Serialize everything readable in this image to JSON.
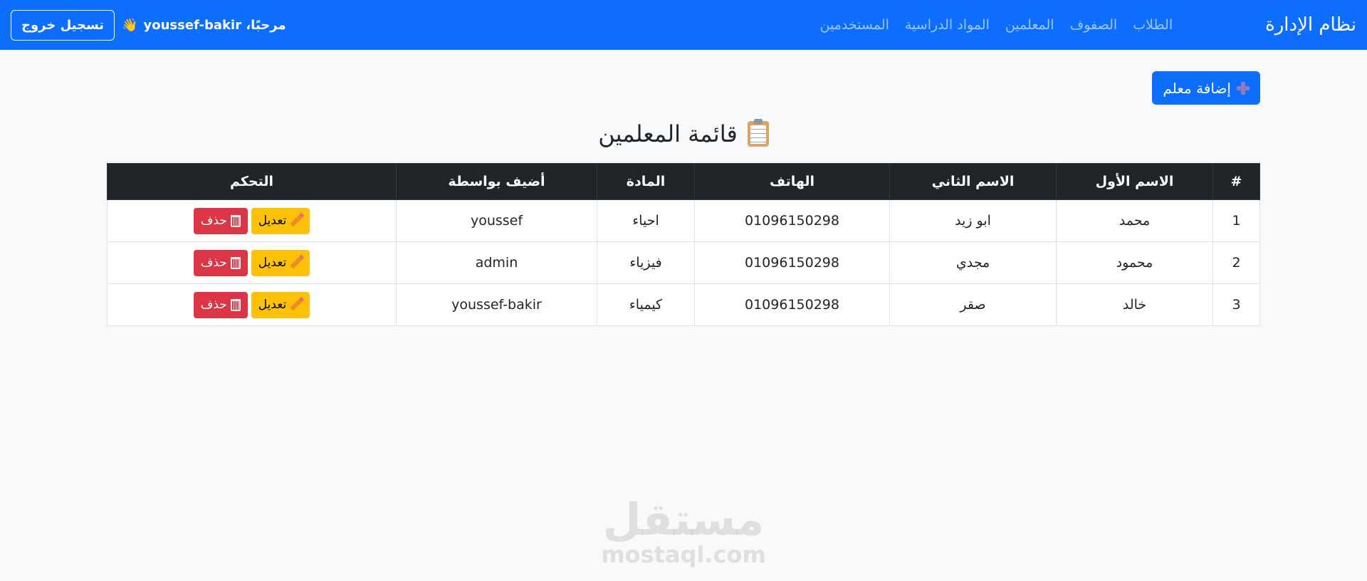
{
  "navbar": {
    "brand": "نظام الإدارة",
    "links": [
      "الطلاب",
      "الصفوف",
      "المعلمين",
      "المواد الدراسية",
      "المستخدمين"
    ],
    "welcome": "مرحبًا، youssef-bakir",
    "welcome_icon": "waving-hand-icon",
    "logout_label": "تسجيل خروج"
  },
  "main": {
    "add_button_label": "إضافة معلم",
    "add_icon": "plus-icon",
    "title": "قائمة المعلمين",
    "title_icon": "clipboard-icon"
  },
  "table": {
    "headers": [
      "#",
      "الاسم الأول",
      "الاسم الثاني",
      "الهاتف",
      "المادة",
      "أضيف بواسطة",
      "التحكم"
    ],
    "rows": [
      [
        "1",
        "محمد",
        "ابو زيد",
        "01096150298",
        "احياء",
        "youssef"
      ],
      [
        "2",
        "محمود",
        "مجدي",
        "01096150298",
        "فيزياء",
        "admin"
      ],
      [
        "3",
        "خالد",
        "صقر",
        "01096150298",
        "كيمياء",
        "youssef-bakir"
      ]
    ],
    "edit_label": "تعديل",
    "delete_label": "حذف"
  },
  "watermark": {
    "logo_text": "مستقل",
    "site": "mostaql.com"
  },
  "colors": {
    "primary": "#0d6efd",
    "warning": "#ffc107",
    "danger": "#dc3545",
    "table_header": "#212529"
  }
}
